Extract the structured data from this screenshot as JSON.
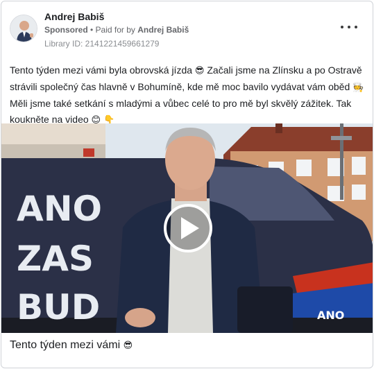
{
  "ad": {
    "page_name": "Andrej Babiš",
    "sponsored_label": "Sponsored",
    "separator": " • ",
    "paid_for_prefix": "Paid for by ",
    "paid_for_by": "Andrej Babiš",
    "library_id": "Library ID: 2141221459661279",
    "more_icon": "more-horizontal-icon",
    "avatar_icon": "profile-avatar"
  },
  "post": {
    "text_parts": [
      "Tento týden mezi vámi byla obrovská jízda ",
      "😎",
      " Začali jsme na Zlínsku a po Ostravě strávili společný čas hlavně v Bohumíně, kde mě moc bavilo vydávat vám oběd ",
      "🧑‍🍳",
      " Měli jsme také setkání s mladými a vůbec celé to pro mě byl skvělý zážitek. Tak koukněte na video ",
      "😊",
      " ",
      "👇"
    ]
  },
  "video": {
    "van_text_line1": "ANO",
    "van_text_line2": "ZAS",
    "van_text_line3": "BUD",
    "van_logo": "ANO",
    "play_icon": "play-icon",
    "colors": {
      "van": "#2a2f45",
      "sky": "#dce6ee",
      "building": "#c98a63",
      "jacket": "#1f2a44",
      "sweater": "#dcdcd8"
    }
  },
  "caption": {
    "text": "Tento týden mezi vámi ",
    "emoji": "😎"
  }
}
